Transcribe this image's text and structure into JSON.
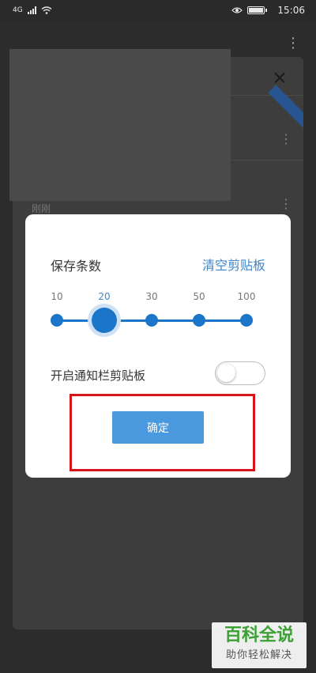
{
  "status_bar": {
    "signal_label": "4G",
    "time": "15:06"
  },
  "background": {
    "item_label": "刚刚"
  },
  "dialog": {
    "title": "保存条数",
    "clear_link": "清空剪贴板",
    "slider": {
      "ticks": [
        "10",
        "20",
        "30",
        "50",
        "100"
      ],
      "selected": "20"
    },
    "notify_label": "开启通知栏剪贴板",
    "notify_enabled": false,
    "confirm_label": "确定"
  },
  "watermark": {
    "top": "百科全说",
    "bottom": "助你轻松解决"
  },
  "colors": {
    "accent": "#3d86c9",
    "slider": "#1b75c9",
    "button": "#4a98dd",
    "highlight": "#d7141a"
  }
}
